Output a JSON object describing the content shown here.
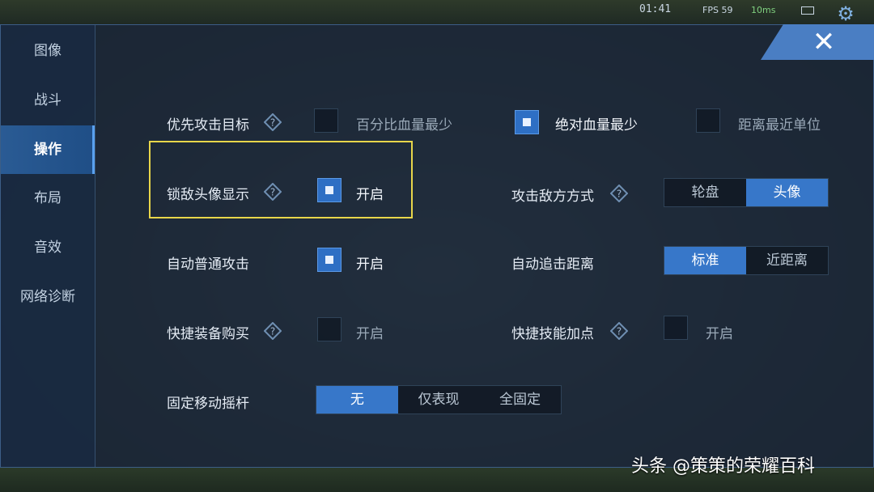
{
  "hud": {
    "time": "01:41",
    "fps": "FPS 59",
    "ping": "10ms"
  },
  "sidebar": {
    "items": [
      {
        "label": "图像",
        "active": false
      },
      {
        "label": "战斗",
        "active": false
      },
      {
        "label": "操作",
        "active": true
      },
      {
        "label": "布局",
        "active": false
      },
      {
        "label": "音效",
        "active": false
      },
      {
        "label": "网络诊断",
        "active": false
      }
    ]
  },
  "close_label": "✕",
  "settings": {
    "target_priority": {
      "label": "优先攻击目标",
      "options": [
        {
          "label": "百分比血量最少",
          "checked": false
        },
        {
          "label": "绝对血量最少",
          "checked": true
        },
        {
          "label": "距离最近单位",
          "checked": false
        }
      ]
    },
    "lock_enemy_avatar": {
      "label": "锁敌头像显示",
      "option": "开启",
      "checked": true
    },
    "attack_enemy_mode": {
      "label": "攻击敌方方式",
      "options": [
        "轮盘",
        "头像"
      ],
      "selected": 1
    },
    "auto_normal_attack": {
      "label": "自动普通攻击",
      "option": "开启",
      "checked": true
    },
    "auto_chase_distance": {
      "label": "自动追击距离",
      "options": [
        "标准",
        "近距离"
      ],
      "selected": 0
    },
    "quick_buy_equipment": {
      "label": "快捷装备购买",
      "option": "开启",
      "checked": false
    },
    "quick_skill_upgrade": {
      "label": "快捷技能加点",
      "option": "开启",
      "checked": false
    },
    "fixed_joystick": {
      "label": "固定移动摇杆",
      "options": [
        "无",
        "仅表现",
        "全固定"
      ],
      "selected": 0
    }
  },
  "watermark": "头条 @策策的荣耀百科",
  "colors": {
    "accent": "#3777c9",
    "highlight": "#e8d64a"
  }
}
